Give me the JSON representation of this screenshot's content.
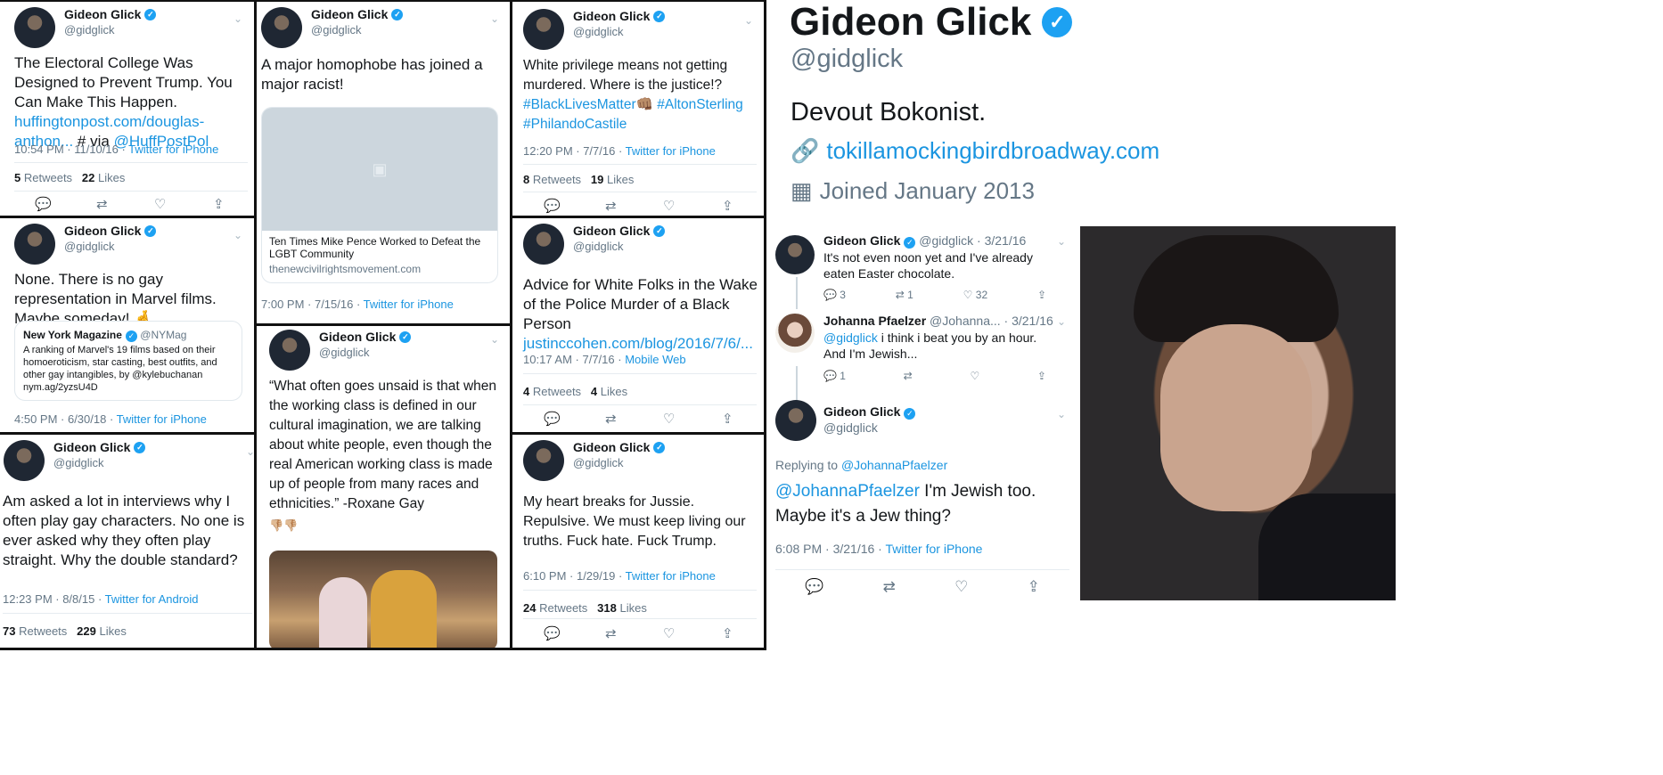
{
  "tweets": {
    "t1": {
      "name": "Gideon Glick",
      "handle": "@gidglick",
      "text": "The Electoral College Was Designed to Prevent Trump. You Can Make This Happen.",
      "link": "huffingtonpost.com/douglas-anthon...",
      "via": "# via",
      "via_handle": "@HuffPostPol",
      "time": "10:54 PM · 11/10/16 · ",
      "source": "Twitter for iPhone",
      "rt_n": "5",
      "rt_l": "Retweets",
      "lk_n": "22",
      "lk_l": "Likes"
    },
    "t2": {
      "name": "Gideon Glick",
      "handle": "@gidglick",
      "text": "None. There is no gay representation in Marvel films. Maybe someday! 🤞",
      "quote_name": "New York Magazine",
      "quote_handle": "@NYMag",
      "quote_text": "A ranking of Marvel's 19 films based on their homoeroticism, star casting, best outfits, and other gay intangibles, by @kylebuchanan nym.ag/2yzsU4D",
      "time": "4:50 PM · 6/30/18 · ",
      "source": "Twitter for iPhone"
    },
    "t3": {
      "name": "Gideon Glick",
      "handle": "@gidglick",
      "text": "Am asked a lot in interviews why I often play gay characters. No one is ever asked why they often play straight. Why the double standard?",
      "time": "12:23 PM · 8/8/15 · ",
      "source": "Twitter for Android",
      "rt_n": "73",
      "rt_l": "Retweets",
      "lk_n": "229",
      "lk_l": "Likes"
    },
    "t4": {
      "name": "Gideon Glick",
      "handle": "@gidglick",
      "text": "A major homophobe has joined a major racist!",
      "card_title": "Ten Times Mike Pence Worked to Defeat the LGBT Community",
      "card_domain": "thenewcivilrightsmovement.com",
      "time": "7:00 PM · 7/15/16 · ",
      "source": "Twitter for iPhone"
    },
    "t5": {
      "name": "Gideon Glick",
      "handle": "@gidglick",
      "text": "“What often goes unsaid is that when the working class is defined in our cultural imagination, we are talking about white people, even though the real American working class is made up of people from many races and ethnicities.” -Roxane Gay",
      "emoji": "👎🏼👎🏼"
    },
    "t6": {
      "name": "Gideon Glick",
      "handle": "@gidglick",
      "text": "White privilege means not getting murdered. Where is the justice!?",
      "tag1": "#BlackLivesMatter",
      "tag2": "#AltonSterling",
      "tag3": "#PhilandoCastile",
      "emoji": "👊🏽",
      "time": "12:20 PM · 7/7/16 · ",
      "source": "Twitter for iPhone",
      "rt_n": "8",
      "rt_l": "Retweets",
      "lk_n": "19",
      "lk_l": "Likes"
    },
    "t7": {
      "name": "Gideon Glick",
      "handle": "@gidglick",
      "text": "Advice for White Folks in the Wake of the Police Murder of a Black Person",
      "link": "justinccohen.com/blog/2016/7/6/...",
      "time": "10:17 AM · 7/7/16 · ",
      "source": "Mobile Web",
      "rt_n": "4",
      "rt_l": "Retweets",
      "lk_n": "4",
      "lk_l": "Likes"
    },
    "t8": {
      "name": "Gideon Glick",
      "handle": "@gidglick",
      "text": "My heart breaks for Jussie. Repulsive. We must keep living our truths. Fuck hate. Fuck Trump.",
      "time": "6:10 PM · 1/29/19 · ",
      "source": "Twitter for iPhone",
      "rt_n": "24",
      "rt_l": "Retweets",
      "lk_n": "318",
      "lk_l": "Likes"
    }
  },
  "profile": {
    "name": "Gideon Glick",
    "handle": "@gidglick",
    "bio": "Devout Bokonist.",
    "url": "tokillamockingbirdbroadway.com",
    "joined": "Joined January 2013"
  },
  "thread": {
    "a": {
      "name": "Gideon Glick",
      "handle": "@gidglick",
      "date": "· 3/21/16",
      "text": "It's not even noon yet and I've already eaten Easter chocolate.",
      "replies": "3",
      "retweets": "1",
      "likes": "32"
    },
    "b": {
      "name": "Johanna Pfaelzer",
      "handle": "@Johanna...",
      "date": "· 3/21/16",
      "mention": "@gidglick",
      "text": "i think i beat you by an hour. And I'm Jewish...",
      "replies": "1"
    },
    "c": {
      "name": "Gideon Glick",
      "handle": "@gidglick",
      "replying_label": "Replying to",
      "replying_to": "@JohannaPfaelzer",
      "mention": "@JohannaPfaelzer",
      "text": "I'm Jewish too. Maybe it's a Jew thing?",
      "time": "6:08 PM · 3/21/16 · ",
      "source": "Twitter for iPhone"
    }
  },
  "icons": {
    "reply": "reply-icon",
    "retweet": "retweet-icon",
    "like": "heart-icon",
    "share": "share-icon",
    "link": "link-icon",
    "calendar": "calendar-icon",
    "verified": "verified-badge-icon"
  },
  "colors": {
    "accent": "#1b95e0",
    "verified": "#1da1f2",
    "muted": "#657786"
  }
}
